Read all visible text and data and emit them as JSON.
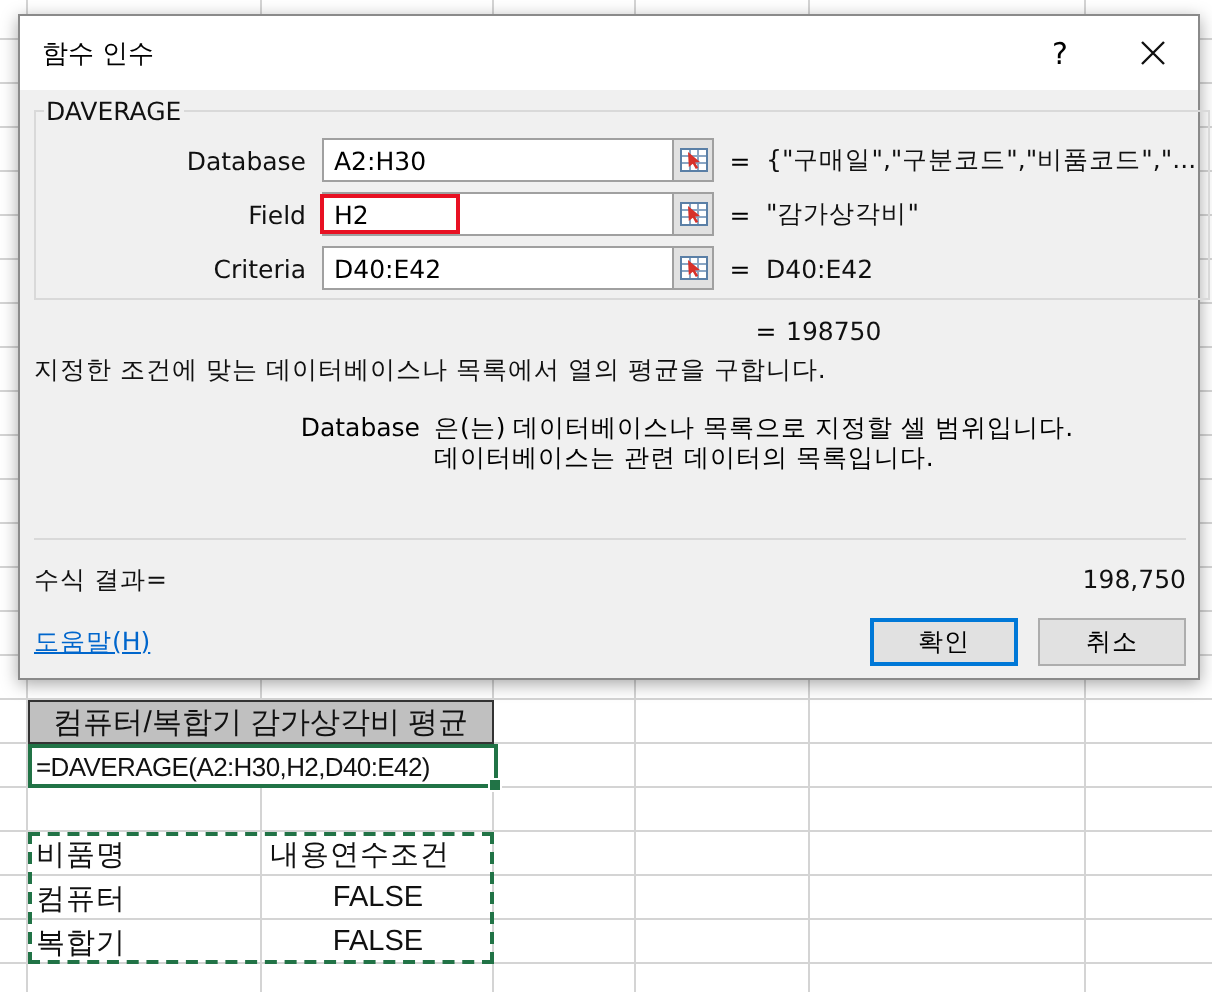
{
  "dialog": {
    "title": "함수 인수",
    "help_glyph": "?",
    "function_name": "DAVERAGE",
    "arguments": [
      {
        "label": "Database",
        "value": "A2:H30",
        "equals": "=",
        "result": "{\"구매일\",\"구분코드\",\"비품코드\",\"...",
        "highlighted": false
      },
      {
        "label": "Field",
        "value": "H2",
        "equals": "=",
        "result": "\"감가상각비\"",
        "highlighted": true
      },
      {
        "label": "Criteria",
        "value": "D40:E42",
        "equals": "=",
        "result": "D40:E42",
        "highlighted": false
      }
    ],
    "total_equals": "=",
    "total_result": "198750",
    "description": "지정한 조건에 맞는 데이터베이스나 목록에서 열의 평균을 구합니다.",
    "argument_help": {
      "name": "Database",
      "lines": [
        "은(는) 데이터베이스나 목록으로 지정할 셀 범위입니다.",
        "데이터베이스는 관련 데이터의 목록입니다."
      ]
    },
    "formula_result_label": "수식 결과=",
    "formula_result": "198,750",
    "help_link": "도움말(H)",
    "buttons": [
      {
        "label": "확인",
        "default": true
      },
      {
        "label": "취소",
        "default": false
      }
    ]
  },
  "sheet": {
    "title_cell": "컴퓨터/복합기 감가상각비 평균",
    "formula": "=DAVERAGE(A2:H30,H2,D40:E42)",
    "criteria_rows": [
      {
        "column_1": "비품명",
        "column_2": "내용연수조건"
      },
      {
        "column_1": "컴퓨터",
        "column_2": "FALSE"
      },
      {
        "column_1": "복합기",
        "column_2": "FALSE"
      }
    ]
  }
}
